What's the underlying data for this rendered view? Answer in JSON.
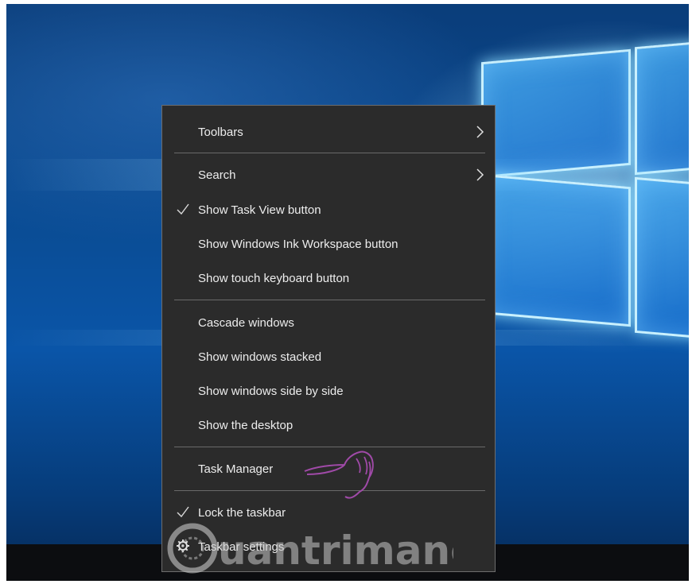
{
  "menu": {
    "items": [
      {
        "label": "Toolbars",
        "checked": false,
        "submenu": true
      },
      {
        "label": "Search",
        "checked": false,
        "submenu": true
      },
      {
        "label": "Show Task View button",
        "checked": true,
        "submenu": false
      },
      {
        "label": "Show Windows Ink Workspace button",
        "checked": false,
        "submenu": false
      },
      {
        "label": "Show touch keyboard button",
        "checked": false,
        "submenu": false
      },
      {
        "label": "Cascade windows",
        "checked": false,
        "submenu": false
      },
      {
        "label": "Show windows stacked",
        "checked": false,
        "submenu": false
      },
      {
        "label": "Show windows side by side",
        "checked": false,
        "submenu": false
      },
      {
        "label": "Show the desktop",
        "checked": false,
        "submenu": false
      },
      {
        "label": "Task Manager",
        "checked": false,
        "submenu": false
      },
      {
        "label": "Lock the taskbar",
        "checked": true,
        "submenu": false
      },
      {
        "label": "Taskbar settings",
        "checked": false,
        "submenu": false,
        "icon": "gear-icon"
      }
    ]
  },
  "watermark": {
    "text": "uantrimang"
  },
  "colors": {
    "menu_bg": "#2b2b2b",
    "accent": "#0a55a8",
    "cursor": "#9b3fa0"
  }
}
